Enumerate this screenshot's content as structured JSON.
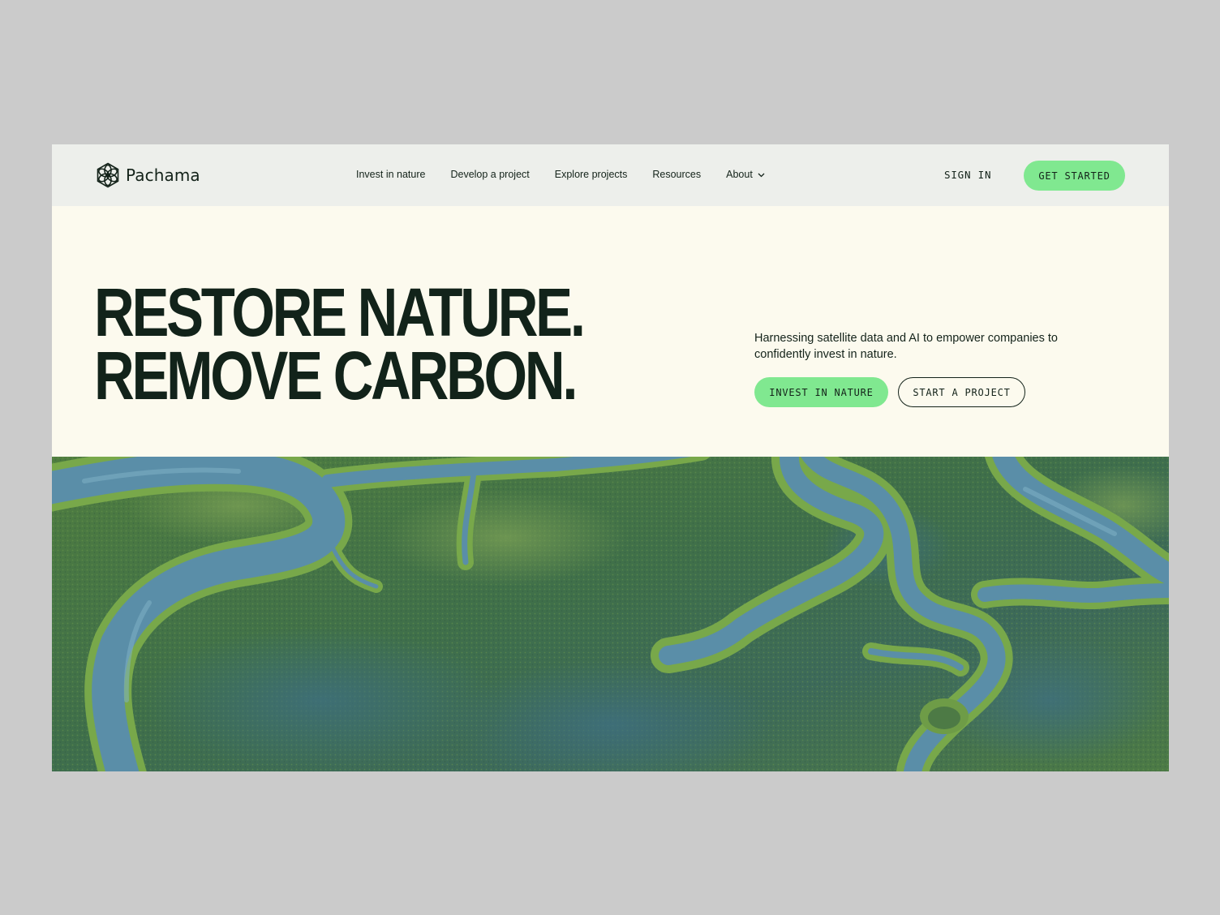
{
  "brand": {
    "name": "Pachama",
    "logo_icon": "flower-hexagon-icon"
  },
  "nav": {
    "links": [
      "Invest in nature",
      "Develop a project",
      "Explore projects",
      "Resources"
    ],
    "about_label": "About",
    "about_icon": "chevron-down-icon",
    "sign_in": "SIGN IN",
    "get_started": "GET STARTED"
  },
  "hero": {
    "headline_line1": "RESTORE NATURE.",
    "headline_line2": "REMOVE CARBON.",
    "description": "Harnessing satellite data and AI to empower companies to confidently invest in nature.",
    "cta_primary": "INVEST IN NATURE",
    "cta_secondary": "START A PROJECT"
  },
  "image": {
    "subject": "aerial-marsh-photo"
  },
  "colors": {
    "page_background": "#cbcbcb",
    "nav_background": "#edefeb",
    "hero_background": "#fcfaee",
    "accent_green": "#80e890",
    "text_dark": "#14231a",
    "marsh_green": "#3d6b45",
    "water_blue": "#5a8ea8"
  }
}
